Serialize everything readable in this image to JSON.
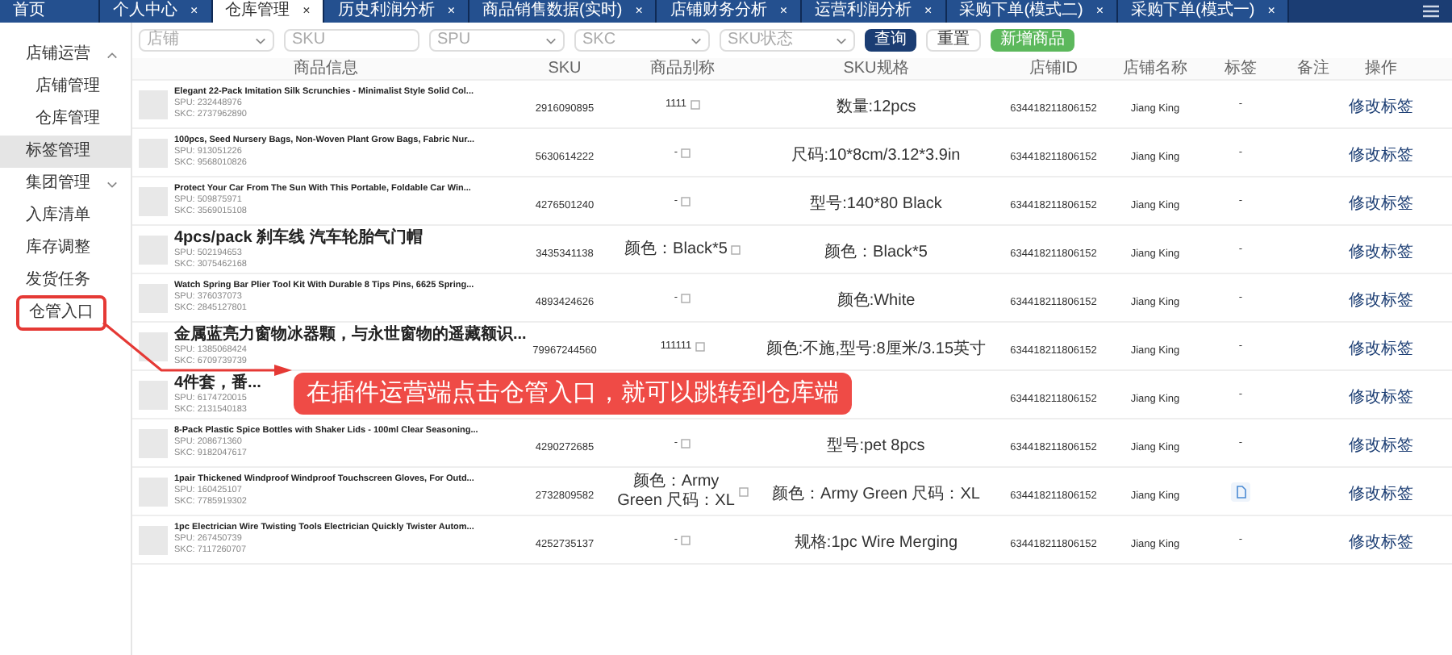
{
  "tabs": [
    {
      "label": "首页",
      "selected": false
    },
    {
      "label": "个人中心",
      "selected": false,
      "close": "×"
    },
    {
      "label": "仓库管理",
      "selected": true,
      "close": "×"
    },
    {
      "label": "历史利润分析",
      "selected": false,
      "close": "×"
    },
    {
      "label": "商品销售数据(实时)",
      "selected": false,
      "close": "×"
    },
    {
      "label": "店铺财务分析",
      "selected": false,
      "close": "×"
    },
    {
      "label": "运营利润分析",
      "selected": false,
      "close": "×"
    },
    {
      "label": "采购下单(模式二)",
      "selected": false,
      "close": "×"
    },
    {
      "label": "采购下单(模式一)",
      "selected": false,
      "close": "×"
    }
  ],
  "sidebar": {
    "items": [
      {
        "label": "店铺运营",
        "selected": false,
        "highlighted": false,
        "expanded": true,
        "children": [
          {
            "label": "店铺管理",
            "selected": false,
            "highlighted": false
          },
          {
            "label": "仓库管理",
            "selected": false,
            "highlighted": false
          }
        ]
      },
      {
        "label": "标签管理",
        "selected": true,
        "highlighted": false
      },
      {
        "label": "集团管理",
        "selected": false,
        "highlighted": false,
        "expanded": false
      },
      {
        "label": "入库清单",
        "selected": false,
        "highlighted": false
      },
      {
        "label": "库存调整",
        "selected": false,
        "highlighted": false
      },
      {
        "label": "发货任务",
        "selected": false,
        "highlighted": false
      },
      {
        "label": "仓管入口",
        "selected": false,
        "highlighted": true
      }
    ]
  },
  "filters": [
    {
      "placeholder": "店铺",
      "kind": "select"
    },
    {
      "placeholder": "SKU",
      "kind": "input"
    },
    {
      "placeholder": "SPU",
      "kind": "select"
    },
    {
      "placeholder": "SKC",
      "kind": "select"
    },
    {
      "placeholder": "SKU状态",
      "kind": "select"
    }
  ],
  "buttons": [
    {
      "label": "查询",
      "kind": "primary"
    },
    {
      "label": "重置",
      "kind": "plain"
    },
    {
      "label": "新增商品",
      "kind": "success"
    }
  ],
  "table": {
    "columns": [
      "商品信息",
      "SKU",
      "商品别称",
      "SKU规格",
      "店铺ID",
      "店铺名称",
      "标签",
      "备注",
      "操作"
    ],
    "rows": [
      {
        "title": "Elegant 22-Pack Imitation Silk Scrunchies - Minimalist Style Solid Col...",
        "spu": "SPU: 232448976",
        "skc": "SKC: 2737962890",
        "sku": "2916090895",
        "alias": "1111",
        "spec": "数量:12pcs",
        "shop_id": "634418211806152",
        "shop_name": "Jiang King",
        "tag": "-",
        "tag_icon": false,
        "action": "修改标签"
      },
      {
        "title": "100pcs, Seed Nursery Bags, Non-Woven Plant Grow Bags, Fabric Nur...",
        "spu": "SPU: 913051226",
        "skc": "SKC: 9568010826",
        "sku": "5630614222",
        "alias": "-",
        "spec": "尺码:10*8cm/3.12*3.9in",
        "shop_id": "634418211806152",
        "shop_name": "Jiang King",
        "tag": "-",
        "tag_icon": false,
        "action": "修改标签"
      },
      {
        "title": "Protect Your Car From The Sun With This Portable, Foldable Car Win...",
        "spu": "SPU: 509875971",
        "skc": "SKC: 3569015108",
        "sku": "4276501240",
        "alias": "-",
        "spec": "型号:140*80 Black",
        "shop_id": "634418211806152",
        "shop_name": "Jiang King",
        "tag": "-",
        "tag_icon": false,
        "action": "修改标签"
      },
      {
        "title": "4pcs/pack 刹车线 汽车轮胎气门帽",
        "spu": "SPU: 502194653",
        "skc": "SKC: 3075462168",
        "sku": "3435341138",
        "alias": "颜色：Black*5",
        "spec": "颜色：Black*5",
        "shop_id": "634418211806152",
        "shop_name": "Jiang King",
        "tag": "-",
        "tag_icon": false,
        "action": "修改标签"
      },
      {
        "title": "Watch Spring Bar Plier Tool Kit With Durable 8 Tips Pins, 6625 Spring...",
        "spu": "SPU: 376037073",
        "skc": "SKC: 2845127801",
        "sku": "4893424626",
        "alias": "-",
        "spec": "颜色:White",
        "shop_id": "634418211806152",
        "shop_name": "Jiang King",
        "tag": "-",
        "tag_icon": false,
        "action": "修改标签"
      },
      {
        "title": "金属蓝亮力窗物冰器颗，与永世窗物的遥藏额识...",
        "spu": "SPU: 1385068424",
        "skc": "SKC: 6709739739",
        "sku": "79967244560",
        "alias": "111111",
        "spec": "颜色:不施,型号:8厘米/3.15英寸",
        "shop_id": "634418211806152",
        "shop_name": "Jiang King",
        "tag": "-",
        "tag_icon": false,
        "action": "修改标签"
      },
      {
        "title": "4件套，番...",
        "spu": "SPU: 6174720015",
        "skc": "SKC: 2131540183",
        "shop_id": "634418211806152",
        "shop_name": "Jiang King",
        "tag": "-",
        "tag_icon": false,
        "action": "修改标签"
      },
      {
        "title": "8-Pack Plastic Spice Bottles with Shaker Lids - 100ml Clear Seasoning...",
        "spu": "SPU: 208671360",
        "skc": "SKC: 9182047617",
        "sku": "4290272685",
        "alias": "-",
        "spec": "型号:pet 8pcs",
        "shop_id": "634418211806152",
        "shop_name": "Jiang King",
        "tag": "-",
        "tag_icon": false,
        "action": "修改标签"
      },
      {
        "title": "1pair Thickened Windproof Windproof Touchscreen Gloves, For Outd...",
        "spu": "SPU: 160425107",
        "skc": "SKC: 7785919302",
        "sku": "2732809582",
        "alias": "颜色：Army Green 尺码：XL",
        "spec": "颜色：Army Green 尺码：XL",
        "shop_id": "634418211806152",
        "shop_name": "Jiang King",
        "tag_icon": true,
        "action": "修改标签"
      },
      {
        "title": "1pc Electrician Wire Twisting Tools Electrician Quickly Twister Autom...",
        "spu": "SPU: 267450739",
        "skc": "SKC: 7117260707",
        "sku": "4252735137",
        "alias": "-",
        "spec": "规格:1pc Wire Merging",
        "shop_id": "634418211806152",
        "shop_name": "Jiang King",
        "tag": "-",
        "tag_icon": false,
        "action": "修改标签"
      }
    ]
  },
  "annotation": {
    "text": "在插件运营端点击仓管入口，就可以跳转到仓库端"
  }
}
